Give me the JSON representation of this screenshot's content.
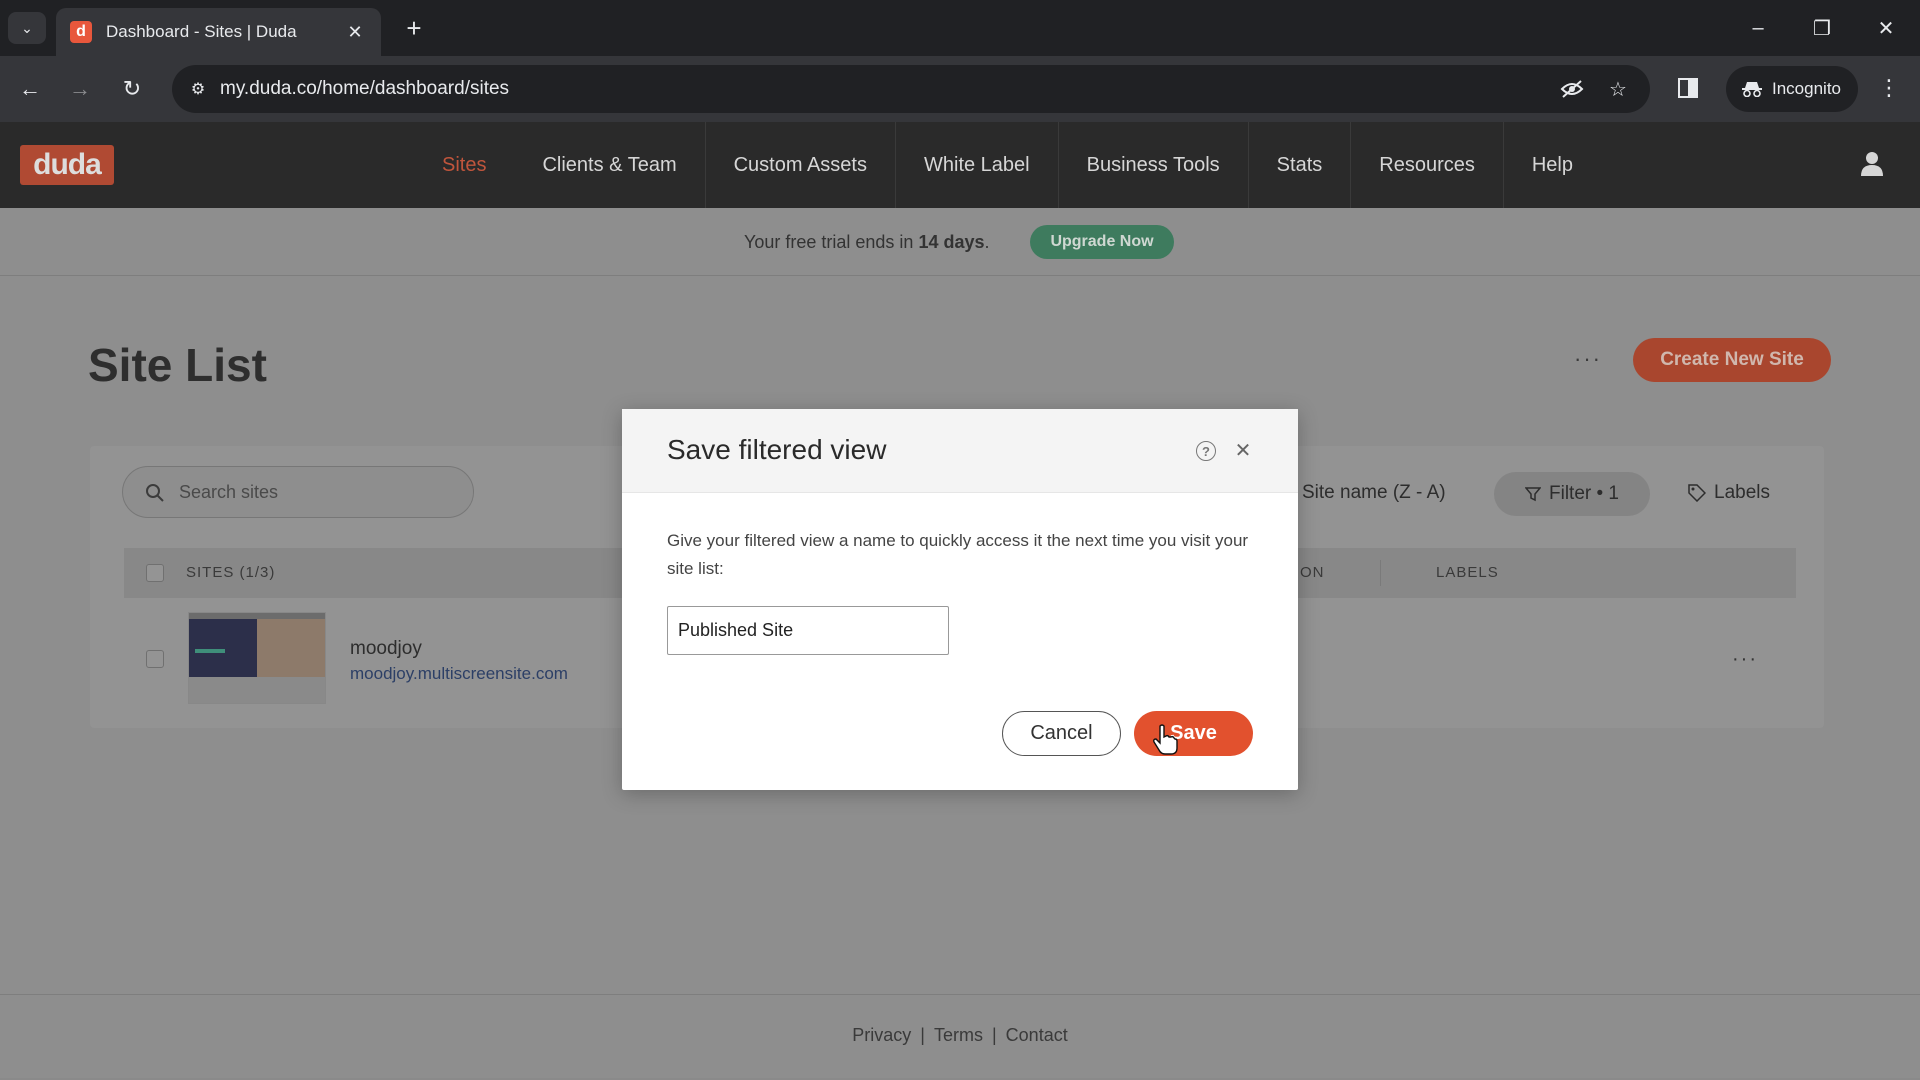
{
  "browser": {
    "tab_title": "Dashboard - Sites | Duda",
    "favicon_letter": "d",
    "url": "my.duda.co/home/dashboard/sites",
    "incognito_label": "Incognito"
  },
  "header": {
    "logo": "duda",
    "nav": [
      "Sites",
      "Clients & Team",
      "Custom Assets",
      "White Label",
      "Business Tools",
      "Stats",
      "Resources",
      "Help"
    ],
    "active_nav": "Sites"
  },
  "trial": {
    "text_before": "Your free trial ends in ",
    "days": "14 days",
    "text_after": ".",
    "upgrade_label": "Upgrade Now"
  },
  "site_list": {
    "title": "Site List",
    "more_label": "···",
    "create_label": "Create New Site",
    "search_placeholder": "Search sites",
    "sort_label": "Site name (Z - A)",
    "filter_label": "Filter • 1",
    "labels_button": "Labels",
    "columns": {
      "sites": "SITES (1/3)",
      "partial": "ON",
      "labels": "LABELS"
    },
    "rows": [
      {
        "name": "moodjoy",
        "url": "moodjoy.multiscreensite.com",
        "more": "···"
      }
    ]
  },
  "footer": {
    "privacy": "Privacy",
    "terms": "Terms",
    "contact": "Contact",
    "separator": "|"
  },
  "modal": {
    "title": "Save filtered view",
    "help_glyph": "?",
    "close_glyph": "✕",
    "description": "Give your filtered view a name to quickly access it the next time you visit your site list:",
    "input_value": "Published Site",
    "cancel_label": "Cancel",
    "save_label": "Save"
  },
  "colors": {
    "accent": "#e2512e",
    "upgrade": "#3e7b5e"
  },
  "icons": [
    "tab-search-icon",
    "close-icon",
    "plus-icon",
    "back-icon",
    "forward-icon",
    "reload-icon",
    "site-settings-icon",
    "eye-off-icon",
    "star-icon",
    "side-panel-icon",
    "incognito-icon",
    "kebab-icon",
    "user-icon",
    "search-icon",
    "filter-icon",
    "tag-icon",
    "help-icon",
    "cursor-icon"
  ]
}
